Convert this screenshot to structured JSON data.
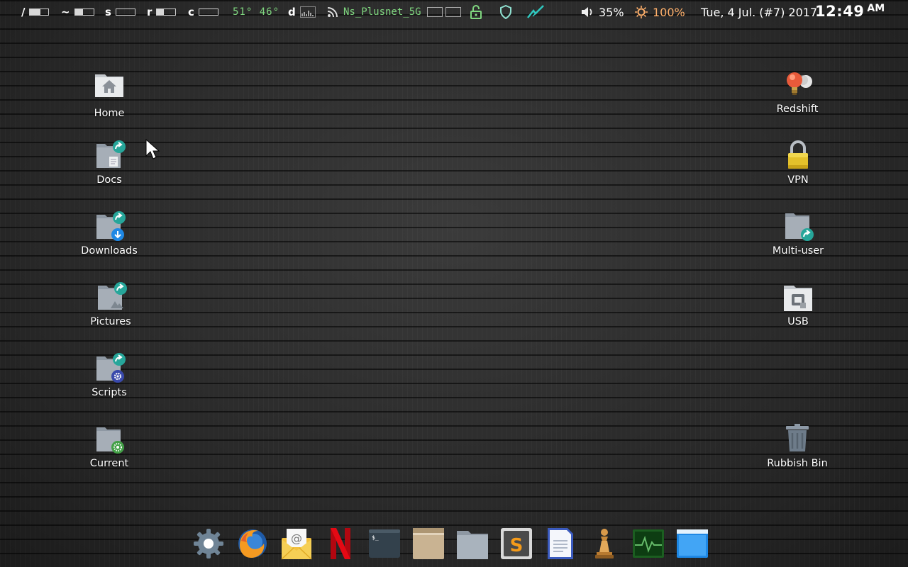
{
  "topbar": {
    "disks": [
      {
        "label": "/",
        "fill": 0.55
      },
      {
        "label": "~",
        "fill": 0.45
      },
      {
        "label": "s",
        "fill": 0.0
      },
      {
        "label": "r",
        "fill": 0.35
      },
      {
        "label": "c",
        "fill": 0.0
      }
    ],
    "temps": "51°  46°",
    "d_label": "d",
    "wifi_ssid": "Ns_Plusnet_5G",
    "volume": "35%",
    "brightness": "100%",
    "date": "Tue, 4 Jul. (#7) 2017",
    "time": "12:49",
    "ampm": "AM"
  },
  "desktop_left": [
    {
      "label": "Home",
      "icon": "home-folder-icon"
    },
    {
      "label": "Docs",
      "icon": "docs-folder-icon"
    },
    {
      "label": "Downloads",
      "icon": "downloads-folder-icon"
    },
    {
      "label": "Pictures",
      "icon": "pictures-folder-icon"
    },
    {
      "label": "Scripts",
      "icon": "scripts-folder-icon"
    },
    {
      "label": "Current",
      "icon": "current-folder-icon"
    }
  ],
  "desktop_right": [
    {
      "label": "Redshift",
      "icon": "redshift-icon"
    },
    {
      "label": "VPN",
      "icon": "padlock-icon"
    },
    {
      "label": "Multi-user",
      "icon": "shared-folder-icon"
    },
    {
      "label": "USB",
      "icon": "usb-drive-icon"
    },
    {
      "label": "Rubbish Bin",
      "icon": "trash-icon"
    }
  ],
  "dock": [
    "settings-gear-icon",
    "firefox-icon",
    "mail-icon",
    "netflix-icon",
    "terminal-icon",
    "file-manager-icon",
    "folder-icon",
    "sublime-text-icon",
    "text-document-icon",
    "chess-icon",
    "system-monitor-icon",
    "window-icon"
  ],
  "colors": {
    "accent_green": "#7fd67f",
    "folder": "#9aa3ad",
    "teal_badge": "#26a69a"
  }
}
